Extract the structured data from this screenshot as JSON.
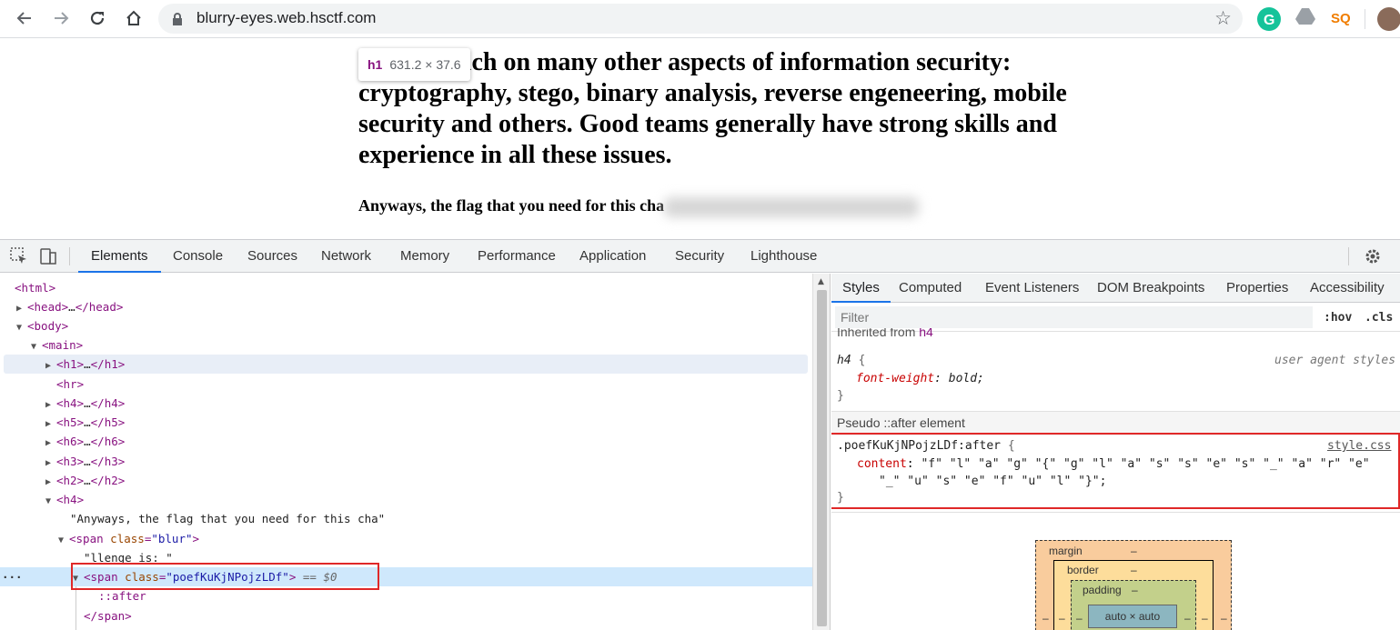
{
  "browser": {
    "url": "blurry-eyes.web.hsctf.com"
  },
  "page": {
    "heading": "s often touch on many other aspects of information security: cryptography, stego, binary analysis, reverse engeneering, mobile security and others. Good teams generally have strong skills and experience in all these issues.",
    "subheading": "Anyways, the flag that you need for this cha",
    "tooltip": {
      "tag": "h1",
      "size": "631.2 × 37.6"
    }
  },
  "devtools": {
    "tabs": [
      "Elements",
      "Console",
      "Sources",
      "Network",
      "Memory",
      "Performance",
      "Application",
      "Security",
      "Lighthouse"
    ],
    "dom": {
      "html_open": "<html>",
      "head_open": "<head>",
      "head_ellipsis": "…",
      "head_close": "</head>",
      "body_open": "<body>",
      "main_open": "<main>",
      "h1_open": "<h1>",
      "h1_close": "</h1>",
      "hr": "<hr>",
      "h4_open": "<h4>",
      "h4_close": "</h4>",
      "h5_open": "<h5>",
      "h5_close": "</h5>",
      "h6_open": "<h6>",
      "h6_close": "</h6>",
      "h3_open": "<h3>",
      "h3_close": "</h3>",
      "h2_open": "<h2>",
      "h2_close": "</h2>",
      "ellipsis": "…",
      "h4_text": "\"Anyways, the flag that you need for this cha\"",
      "span_tag": "<span",
      "span_attr": "class",
      "span_blur_val": "\"blur\"",
      "span_text": "\"llenge is: \"",
      "span_secret_val": "\"poefKuKjNPojzLDf\"",
      "eq0": "== $0",
      "after": "::after",
      "span_close": "</span>",
      "gt": ">",
      "equals": "="
    },
    "styles": {
      "tabs": [
        "Styles",
        "Computed",
        "Event Listeners",
        "DOM Breakpoints",
        "Properties",
        "Accessibility"
      ],
      "filter_placeholder": "Filter",
      "hov": ":hov",
      "cls": ".cls",
      "inherited_label": "Inherited from",
      "inherited_tag": "h4",
      "rule1": {
        "selector": "h4",
        "source": "user agent styles",
        "property": "font-weight",
        "value": "bold;"
      },
      "pseudo_header": "Pseudo ::after element",
      "rule2": {
        "selector": ".poefKuKjNPojzLDf:after",
        "source": "style.css",
        "property": "content",
        "value_line1": "\"f\" \"l\" \"a\" \"g\" \"{\" \"g\" \"l\" \"a\" \"s\" \"s\" \"e\" \"s\" \"_\" \"a\" \"r\" \"e\"",
        "value_line2": "\"_\" \"u\" \"s\" \"e\" \"f\" \"u\" \"l\" \"}\";"
      },
      "open_brace": "{",
      "close_brace": "}",
      "colon": ":"
    },
    "box_model": {
      "margin_label": "margin",
      "margin_value": "–",
      "border_label": "border",
      "border_value": "–",
      "padding_label": "padding",
      "padding_value": "–",
      "content": "auto × auto",
      "side_value": "–"
    }
  },
  "colors": {
    "accent": "#1a73e8",
    "highlight": "#e02828",
    "margin_box": "#f9cc9d",
    "border_box": "#fddd9b",
    "padding_box": "#c3d08b",
    "content_box": "#8cb6c0"
  }
}
